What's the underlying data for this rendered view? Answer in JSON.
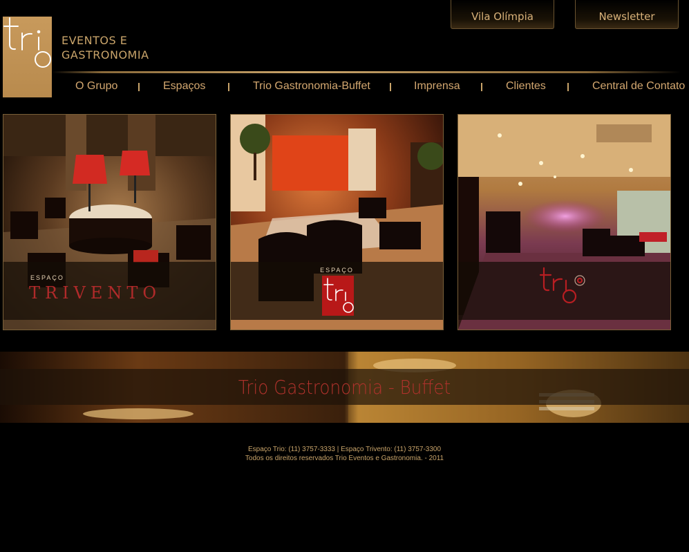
{
  "header": {
    "brand_line1": "EVENTOS E",
    "brand_line2": "GASTRONOMIA",
    "top_buttons": [
      "Vila Olímpia",
      "Newsletter"
    ]
  },
  "nav": {
    "items": [
      "O Grupo",
      "Espaços",
      "Trio Gastronomia-Buffet",
      "Imprensa",
      "Clientes",
      "Central de Contato"
    ]
  },
  "cards": [
    {
      "small": "ESPAÇO",
      "name": "TRIVENTO"
    },
    {
      "small": "ESPAÇO",
      "name": "trio"
    },
    {
      "name": "trio"
    }
  ],
  "banner": {
    "title": "Trio Gastronomia - Buffet"
  },
  "footer": {
    "line1": "Espaço Trio: (11) 3757-3333 | Espaço Trivento: (11) 3757-3300",
    "line2": "Todos os direitos reservados Trio Eventos e Gastronomia. - 2011"
  },
  "colors": {
    "gold": "#c9a46a",
    "red": "#b02a2a",
    "background": "#000000"
  }
}
